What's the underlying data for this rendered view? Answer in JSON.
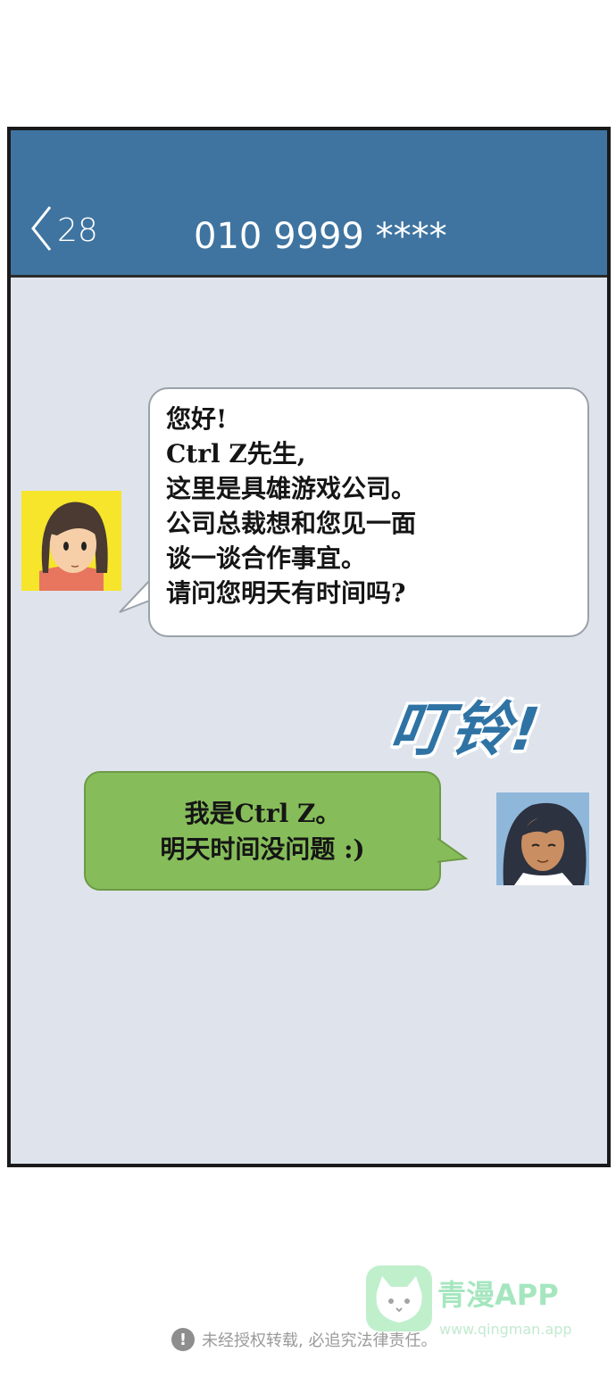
{
  "header": {
    "back_count": "28",
    "phone_number": "010 9999 ****",
    "background_color": "#3f74a0"
  },
  "messages": {
    "incoming": {
      "lines": [
        "您好!",
        "Ctrl Z先生,",
        "这里是具雄游戏公司。",
        "公司总裁想和您见一面",
        "谈一谈合作事宜。",
        "请问您明天有时间吗?"
      ]
    },
    "outgoing": {
      "lines": [
        "我是Ctrl Z。",
        "明天时间没问题 :)"
      ],
      "bubble_color": "#86bd5a"
    }
  },
  "sound_effect": "叮铃!",
  "footer": {
    "notice": "未经授权转载, 必追究法律责任。",
    "watermark_name": "青漫APP",
    "watermark_url": "www.qingman.app"
  }
}
